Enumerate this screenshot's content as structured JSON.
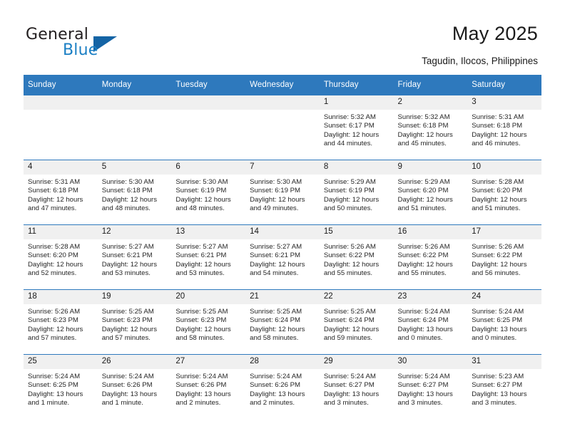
{
  "brand": {
    "name_part1": "General",
    "name_part2": "Blue",
    "accent_color": "#1464a5",
    "text_color": "#1b7fc4"
  },
  "header": {
    "title": "May 2025",
    "subtitle": "Tagudin, Ilocos, Philippines",
    "header_bg": "#2e79bd",
    "daynum_bg": "#f0f0f0"
  },
  "weekdays": [
    "Sunday",
    "Monday",
    "Tuesday",
    "Wednesday",
    "Thursday",
    "Friday",
    "Saturday"
  ],
  "labels": {
    "sunrise_prefix": "Sunrise:",
    "sunset_prefix": "Sunset:",
    "daylight_prefix": "Daylight:"
  },
  "weeks": [
    [
      {
        "day": "",
        "sunrise": "",
        "sunset": "",
        "daylight_line1": "",
        "daylight_line2": ""
      },
      {
        "day": "",
        "sunrise": "",
        "sunset": "",
        "daylight_line1": "",
        "daylight_line2": ""
      },
      {
        "day": "",
        "sunrise": "",
        "sunset": "",
        "daylight_line1": "",
        "daylight_line2": ""
      },
      {
        "day": "",
        "sunrise": "",
        "sunset": "",
        "daylight_line1": "",
        "daylight_line2": ""
      },
      {
        "day": "1",
        "sunrise": "Sunrise: 5:32 AM",
        "sunset": "Sunset: 6:17 PM",
        "daylight_line1": "Daylight: 12 hours",
        "daylight_line2": "and 44 minutes."
      },
      {
        "day": "2",
        "sunrise": "Sunrise: 5:32 AM",
        "sunset": "Sunset: 6:18 PM",
        "daylight_line1": "Daylight: 12 hours",
        "daylight_line2": "and 45 minutes."
      },
      {
        "day": "3",
        "sunrise": "Sunrise: 5:31 AM",
        "sunset": "Sunset: 6:18 PM",
        "daylight_line1": "Daylight: 12 hours",
        "daylight_line2": "and 46 minutes."
      }
    ],
    [
      {
        "day": "4",
        "sunrise": "Sunrise: 5:31 AM",
        "sunset": "Sunset: 6:18 PM",
        "daylight_line1": "Daylight: 12 hours",
        "daylight_line2": "and 47 minutes."
      },
      {
        "day": "5",
        "sunrise": "Sunrise: 5:30 AM",
        "sunset": "Sunset: 6:18 PM",
        "daylight_line1": "Daylight: 12 hours",
        "daylight_line2": "and 48 minutes."
      },
      {
        "day": "6",
        "sunrise": "Sunrise: 5:30 AM",
        "sunset": "Sunset: 6:19 PM",
        "daylight_line1": "Daylight: 12 hours",
        "daylight_line2": "and 48 minutes."
      },
      {
        "day": "7",
        "sunrise": "Sunrise: 5:30 AM",
        "sunset": "Sunset: 6:19 PM",
        "daylight_line1": "Daylight: 12 hours",
        "daylight_line2": "and 49 minutes."
      },
      {
        "day": "8",
        "sunrise": "Sunrise: 5:29 AM",
        "sunset": "Sunset: 6:19 PM",
        "daylight_line1": "Daylight: 12 hours",
        "daylight_line2": "and 50 minutes."
      },
      {
        "day": "9",
        "sunrise": "Sunrise: 5:29 AM",
        "sunset": "Sunset: 6:20 PM",
        "daylight_line1": "Daylight: 12 hours",
        "daylight_line2": "and 51 minutes."
      },
      {
        "day": "10",
        "sunrise": "Sunrise: 5:28 AM",
        "sunset": "Sunset: 6:20 PM",
        "daylight_line1": "Daylight: 12 hours",
        "daylight_line2": "and 51 minutes."
      }
    ],
    [
      {
        "day": "11",
        "sunrise": "Sunrise: 5:28 AM",
        "sunset": "Sunset: 6:20 PM",
        "daylight_line1": "Daylight: 12 hours",
        "daylight_line2": "and 52 minutes."
      },
      {
        "day": "12",
        "sunrise": "Sunrise: 5:27 AM",
        "sunset": "Sunset: 6:21 PM",
        "daylight_line1": "Daylight: 12 hours",
        "daylight_line2": "and 53 minutes."
      },
      {
        "day": "13",
        "sunrise": "Sunrise: 5:27 AM",
        "sunset": "Sunset: 6:21 PM",
        "daylight_line1": "Daylight: 12 hours",
        "daylight_line2": "and 53 minutes."
      },
      {
        "day": "14",
        "sunrise": "Sunrise: 5:27 AM",
        "sunset": "Sunset: 6:21 PM",
        "daylight_line1": "Daylight: 12 hours",
        "daylight_line2": "and 54 minutes."
      },
      {
        "day": "15",
        "sunrise": "Sunrise: 5:26 AM",
        "sunset": "Sunset: 6:22 PM",
        "daylight_line1": "Daylight: 12 hours",
        "daylight_line2": "and 55 minutes."
      },
      {
        "day": "16",
        "sunrise": "Sunrise: 5:26 AM",
        "sunset": "Sunset: 6:22 PM",
        "daylight_line1": "Daylight: 12 hours",
        "daylight_line2": "and 55 minutes."
      },
      {
        "day": "17",
        "sunrise": "Sunrise: 5:26 AM",
        "sunset": "Sunset: 6:22 PM",
        "daylight_line1": "Daylight: 12 hours",
        "daylight_line2": "and 56 minutes."
      }
    ],
    [
      {
        "day": "18",
        "sunrise": "Sunrise: 5:26 AM",
        "sunset": "Sunset: 6:23 PM",
        "daylight_line1": "Daylight: 12 hours",
        "daylight_line2": "and 57 minutes."
      },
      {
        "day": "19",
        "sunrise": "Sunrise: 5:25 AM",
        "sunset": "Sunset: 6:23 PM",
        "daylight_line1": "Daylight: 12 hours",
        "daylight_line2": "and 57 minutes."
      },
      {
        "day": "20",
        "sunrise": "Sunrise: 5:25 AM",
        "sunset": "Sunset: 6:23 PM",
        "daylight_line1": "Daylight: 12 hours",
        "daylight_line2": "and 58 minutes."
      },
      {
        "day": "21",
        "sunrise": "Sunrise: 5:25 AM",
        "sunset": "Sunset: 6:24 PM",
        "daylight_line1": "Daylight: 12 hours",
        "daylight_line2": "and 58 minutes."
      },
      {
        "day": "22",
        "sunrise": "Sunrise: 5:25 AM",
        "sunset": "Sunset: 6:24 PM",
        "daylight_line1": "Daylight: 12 hours",
        "daylight_line2": "and 59 minutes."
      },
      {
        "day": "23",
        "sunrise": "Sunrise: 5:24 AM",
        "sunset": "Sunset: 6:24 PM",
        "daylight_line1": "Daylight: 13 hours",
        "daylight_line2": "and 0 minutes."
      },
      {
        "day": "24",
        "sunrise": "Sunrise: 5:24 AM",
        "sunset": "Sunset: 6:25 PM",
        "daylight_line1": "Daylight: 13 hours",
        "daylight_line2": "and 0 minutes."
      }
    ],
    [
      {
        "day": "25",
        "sunrise": "Sunrise: 5:24 AM",
        "sunset": "Sunset: 6:25 PM",
        "daylight_line1": "Daylight: 13 hours",
        "daylight_line2": "and 1 minute."
      },
      {
        "day": "26",
        "sunrise": "Sunrise: 5:24 AM",
        "sunset": "Sunset: 6:26 PM",
        "daylight_line1": "Daylight: 13 hours",
        "daylight_line2": "and 1 minute."
      },
      {
        "day": "27",
        "sunrise": "Sunrise: 5:24 AM",
        "sunset": "Sunset: 6:26 PM",
        "daylight_line1": "Daylight: 13 hours",
        "daylight_line2": "and 2 minutes."
      },
      {
        "day": "28",
        "sunrise": "Sunrise: 5:24 AM",
        "sunset": "Sunset: 6:26 PM",
        "daylight_line1": "Daylight: 13 hours",
        "daylight_line2": "and 2 minutes."
      },
      {
        "day": "29",
        "sunrise": "Sunrise: 5:24 AM",
        "sunset": "Sunset: 6:27 PM",
        "daylight_line1": "Daylight: 13 hours",
        "daylight_line2": "and 3 minutes."
      },
      {
        "day": "30",
        "sunrise": "Sunrise: 5:24 AM",
        "sunset": "Sunset: 6:27 PM",
        "daylight_line1": "Daylight: 13 hours",
        "daylight_line2": "and 3 minutes."
      },
      {
        "day": "31",
        "sunrise": "Sunrise: 5:23 AM",
        "sunset": "Sunset: 6:27 PM",
        "daylight_line1": "Daylight: 13 hours",
        "daylight_line2": "and 3 minutes."
      }
    ]
  ]
}
